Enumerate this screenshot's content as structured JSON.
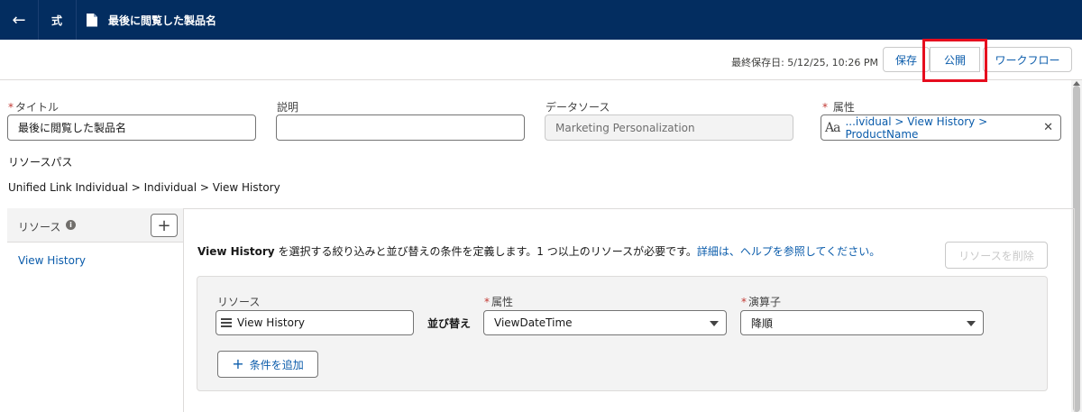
{
  "nav": {
    "back_icon": "arrow-left-icon",
    "type_tab": "式",
    "doc_icon": "document-icon",
    "title": "最後に閲覧した製品名"
  },
  "toolbar": {
    "last_saved": "最終保存日: 5/12/25, 10:26 PM",
    "save_label": "保存",
    "publish_label": "公開",
    "workflow_label": "ワークフロー"
  },
  "fields": {
    "title_label": "タイトル",
    "title_value": "最後に閲覧した製品名",
    "description_label": "説明",
    "description_value": "",
    "datasource_label": "データソース",
    "datasource_value": "Marketing Personalization",
    "attribute_label": "属性",
    "attribute_value": "...ividual > View History > ProductName",
    "required_mark": "*",
    "attr_icon_text": "Aa"
  },
  "resource_path": {
    "label": "リソースパス",
    "path": "Unified Link Individual > Individual > View History"
  },
  "resources": {
    "header": "リソース",
    "info_glyph": "i",
    "add_glyph": "+",
    "items": [
      {
        "label": "View History"
      }
    ]
  },
  "detail": {
    "desc_bold": "View History",
    "desc_text": " を選択する絞り込みと並び替えの条件を定義します。1 つ以上のリソースが必要です。",
    "desc_link": "詳細は、ヘルプを参照してください。",
    "delete_label": "リソースを削除",
    "condition": {
      "resource_label": "リソース",
      "resource_value": "View History",
      "sort_label": "並び替え",
      "attribute_label": "属性",
      "attribute_value": "ViewDateTime",
      "operator_label": "演算子",
      "operator_value": "降順"
    },
    "add_condition_label": "条件を追加",
    "add_glyph": "+"
  }
}
